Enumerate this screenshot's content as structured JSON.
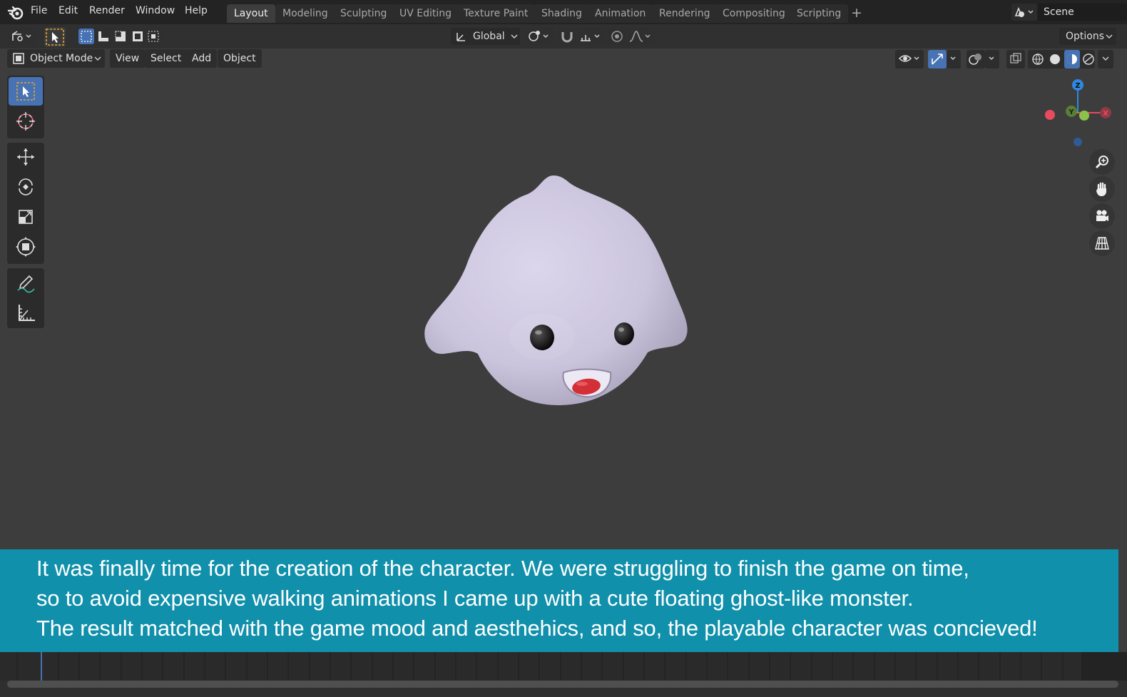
{
  "menubar": {
    "items": [
      "File",
      "Edit",
      "Render",
      "Window",
      "Help"
    ],
    "workspaces": [
      "Layout",
      "Modeling",
      "Sculpting",
      "UV Editing",
      "Texture Paint",
      "Shading",
      "Animation",
      "Rendering",
      "Compositing",
      "Scripting"
    ],
    "active_workspace": "Layout",
    "add_workspace": "+",
    "scene_name": "Scene"
  },
  "tool_header": {
    "transform_orientation": "Global",
    "options_label": "Options"
  },
  "viewport_header": {
    "mode": "Object Mode",
    "menus": [
      "View",
      "Select",
      "Add",
      "Object"
    ]
  },
  "toolbar": {
    "tools": [
      "select-box",
      "cursor",
      "move",
      "rotate",
      "scale",
      "transform",
      "annotate",
      "measure"
    ],
    "active_tool": "select-box"
  },
  "gizmo": {
    "axes": {
      "x": "X",
      "y": "Y",
      "z": "Z"
    },
    "colors": {
      "x": "#e84a5f",
      "y": "#8bc34a",
      "z": "#2f88e0"
    }
  },
  "caption": {
    "line1": "It was finally time for the creation of the character.  We were struggling to finish the game on time,",
    "line2": "so to avoid expensive walking animations I came up with a cute floating ghost-like monster.",
    "line3": "The result matched with the game mood and aesthehics, and so, the playable character was concieved!",
    "background": "#1190ab"
  },
  "colors": {
    "accent": "#4772b3",
    "viewport_bg": "#3d3d3d",
    "ghost_body": "#cfc8e0",
    "tongue": "#d22f36"
  }
}
